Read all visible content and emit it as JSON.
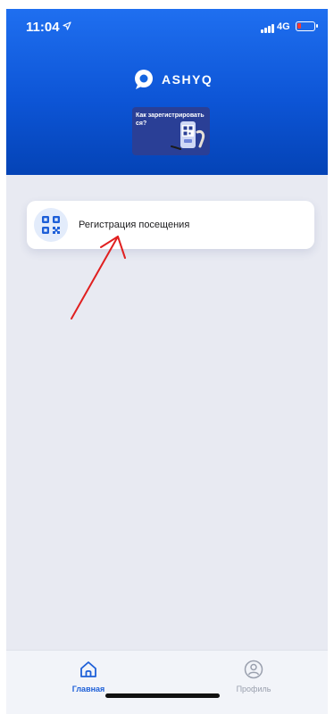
{
  "status_bar": {
    "time": "11:04",
    "network": "4G"
  },
  "app": {
    "brand": "ASHYQ"
  },
  "banner": {
    "text": "Как зарегистрировать ся?"
  },
  "main": {
    "visit_registration_label": "Регистрация посещения"
  },
  "tabs": [
    {
      "label": "Главная",
      "active": true,
      "icon": "home-icon"
    },
    {
      "label": "Профиль",
      "active": false,
      "icon": "profile-icon"
    }
  ],
  "colors": {
    "header": "#0d55d6",
    "accent": "#1d5fd8",
    "background": "#e8eaf2",
    "annotation_arrow": "#e02020",
    "battery_low": "#ff3b30"
  }
}
